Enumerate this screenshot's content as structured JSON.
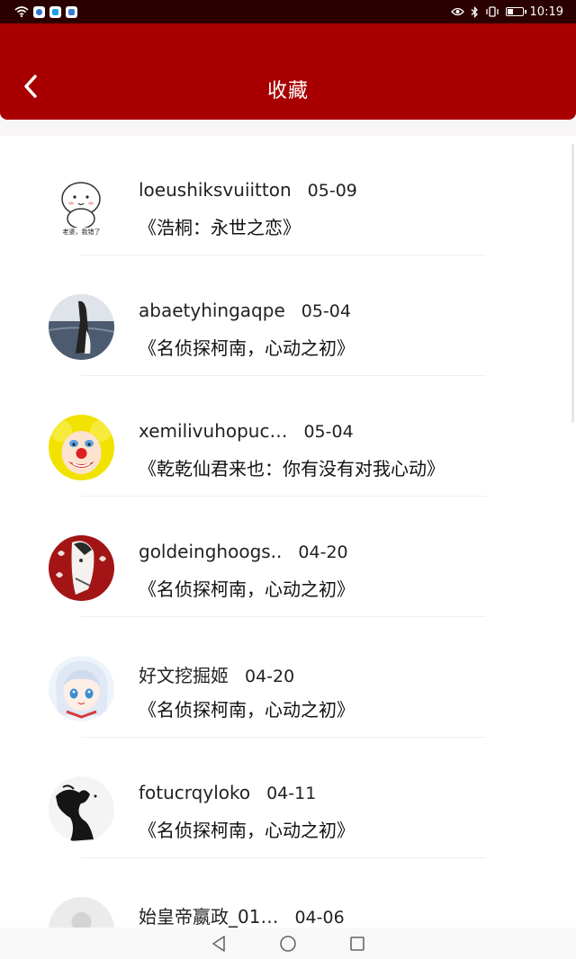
{
  "status_bar": {
    "time": "10:19",
    "battery_level": 0.35
  },
  "header": {
    "title": "收藏",
    "back_icon": "chevron-left-icon",
    "color": "#a80000"
  },
  "favorites": [
    {
      "username": "loeushiksvuiitton",
      "date": "05-09",
      "title": "《浩桐：永世之恋》",
      "avatar": "cartoon-avatar"
    },
    {
      "username": "abaetyhingaqpe",
      "date": "05-04",
      "title": "《名侦探柯南，心动之初》",
      "avatar": "seaside-photo-avatar"
    },
    {
      "username": "xemilivuhopuc…",
      "date": "05-04",
      "title": "《乾乾仙君来也：你有没有对我心动》",
      "avatar": "clown-avatar"
    },
    {
      "username": "goldeinghoogs..",
      "date": "04-20",
      "title": "《名侦探柯南，心动之初》",
      "avatar": "anime-red-avatar"
    },
    {
      "username": "好文挖掘姬",
      "date": "04-20",
      "title": "《名侦探柯南，心动之初》",
      "avatar": "anime-girl-avatar"
    },
    {
      "username": "fotucrqyloko",
      "date": "04-11",
      "title": "《名侦探柯南，心动之初》",
      "avatar": "silhouette-avatar"
    },
    {
      "username": "始皇帝嬴政_01…",
      "date": "04-06",
      "title": "",
      "avatar": "default-avatar"
    }
  ],
  "nav_bar": {
    "back": "triangle-back-icon",
    "home": "circle-home-icon",
    "recents": "square-recents-icon"
  }
}
